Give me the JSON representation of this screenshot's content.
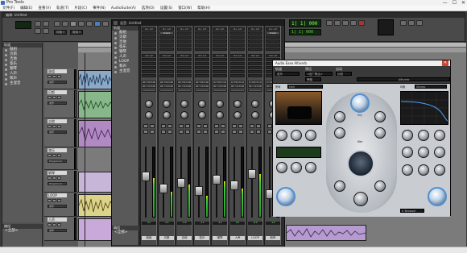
{
  "app": {
    "title": "Pro Tools",
    "window_controls": [
      "—",
      "☐",
      "✕"
    ]
  },
  "menubar": [
    "文件(F)",
    "编辑(E)",
    "查看(V)",
    "轨道(T)",
    "片段(C)",
    "事件(N)",
    "AudioSuite(A)",
    "选项(O)",
    "设置(S)",
    "窗口(W)",
    "帮助(H)"
  ],
  "edit_window": {
    "title": "编辑: Untitled",
    "counter_main": "1|  1| 000",
    "counter_sub": "1|  1| 000",
    "grid_label": "网格 ▾",
    "nudge_label": "微调 ▾",
    "tracks_panel_title": "轨道",
    "tracks": [
      "鼓组",
      "贝斯",
      "吉他",
      "弦乐",
      "钢琴",
      "人声",
      "和声",
      "主混音"
    ],
    "groups_panel_title": "编组",
    "groups": [
      "<全部>"
    ],
    "track_headers": [
      {
        "name": "鼓组",
        "mode": "波形",
        "sub": "读取"
      },
      {
        "name": "贝斯",
        "mode": "波形",
        "sub": "读取"
      },
      {
        "name": "吉他",
        "mode": "波形",
        "sub": "读取"
      },
      {
        "name": "弦乐",
        "mode": "波形",
        "sub": "Polyphonic"
      },
      {
        "name": "钢琴",
        "mode": "波形",
        "sub": "Polyphonic"
      },
      {
        "name": "LOOP",
        "mode": "波形",
        "sub": "读取"
      },
      {
        "name": "人声",
        "mode": "波形",
        "sub": "读取"
      }
    ]
  },
  "mix_window": {
    "title": "混音: Untitled",
    "tracks_panel_title": "轨道",
    "tracks": [
      "鼓组",
      "贝斯",
      "吉他",
      "弦乐",
      "钢琴",
      "人声",
      "LOOP",
      "和声",
      "主混音"
    ],
    "groups_panel_title": "编组",
    "groups": [
      "<全部>"
    ],
    "strips": [
      {
        "name": "鼓组",
        "insert": "",
        "input": "输入 1-2",
        "output": "输出 1-2",
        "volume": "0.0",
        "level": 0.55
      },
      {
        "name": "贝斯",
        "insert": "D-Verb",
        "input": "输入 3-4",
        "output": "输出 1-2",
        "volume": "-2.4",
        "level": 0.35
      },
      {
        "name": "吉他",
        "insert": "",
        "input": "输入 5-6",
        "output": "输出 1-2",
        "volume": "-4.0",
        "level": 0.45
      },
      {
        "name": "弦乐",
        "insert": "",
        "input": "输入 7-8",
        "output": "输出 1-2",
        "volume": "-1.5",
        "level": 0.3
      },
      {
        "name": "钢琴",
        "insert": "",
        "input": "输入 9-10",
        "output": "输出 1-2",
        "volume": "-3.2",
        "level": 0.5
      },
      {
        "name": "人声",
        "insert": "",
        "input": "输入 11-12",
        "output": "输出 1-2",
        "volume": "0.0",
        "level": 0.4
      },
      {
        "name": "LOOP",
        "insert": "",
        "input": "输入 13-14",
        "output": "输出 1-2",
        "volume": "-6.0",
        "level": 0.6
      },
      {
        "name": "和声",
        "insert": "D-Verb",
        "input": "输入 15-16",
        "output": "输出 1-2",
        "volume": "-1.0",
        "level": 0.25
      }
    ],
    "insert_header": "插入 A-E",
    "send_header": "发送 A-E"
  },
  "plugin": {
    "title": "Audio Ease Altiverb",
    "track_label": "轨道",
    "preset_label": "预设",
    "auto_label": "自动",
    "track_value": "弦乐",
    "preset_value": "<出厂默认>",
    "compare_label": "比较",
    "bypass_label": "旁路",
    "plugin_name": "Altiverb",
    "room_label": "房间",
    "room_value": "Hall",
    "eq_label": "均衡",
    "mode_label": "Stereo",
    "knobs_center": [
      {
        "label": "Dry",
        "value": "0.0"
      },
      {
        "label": "Wet",
        "value": "-6.0"
      }
    ],
    "bottom_labels": [
      "Early",
      "Tail",
      "Size",
      "Decay",
      "Bass",
      "Mid",
      "Treble",
      "Damp"
    ],
    "bottom_right": "Ir Browser"
  },
  "status": {
    "text": ""
  }
}
